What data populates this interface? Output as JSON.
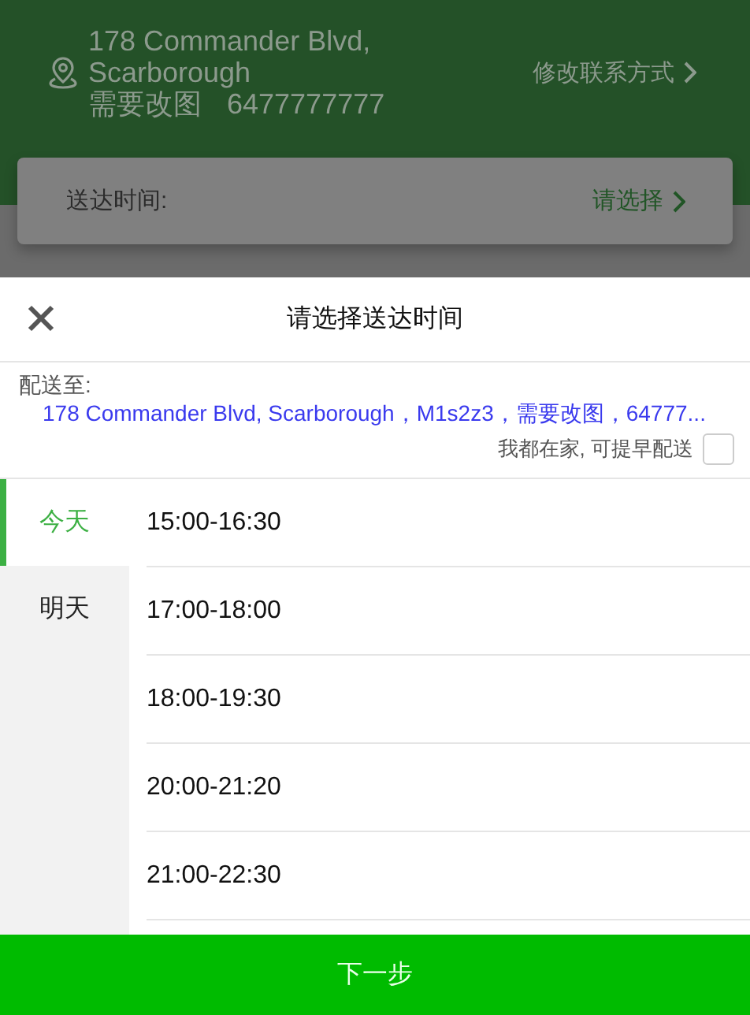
{
  "header": {
    "address_line_1": "178 Commander Blvd,",
    "address_line_2": "Scarborough",
    "contact_name": "需要改图",
    "phone": "6477777777",
    "edit_contact_link": "修改联系方式"
  },
  "delivery_card": {
    "label": "送达时间:",
    "action": "请选择"
  },
  "sheet": {
    "title": "请选择送达时间",
    "deliver_to_label": "配送至:",
    "address": "178 Commander Blvd, Scarborough，M1s2z3，需要改图，64777...",
    "early_delivery": {
      "label": "我都在家, 可提早配送",
      "checked": false
    }
  },
  "days": [
    {
      "label": "今天",
      "selected": true
    },
    {
      "label": "明天",
      "selected": false
    }
  ],
  "time_slots": [
    {
      "label": "15:00-16:30"
    },
    {
      "label": "17:00-18:00"
    },
    {
      "label": "18:00-19:30"
    },
    {
      "label": "20:00-21:20"
    },
    {
      "label": "21:00-22:30"
    }
  ],
  "next_button": "下一步"
}
